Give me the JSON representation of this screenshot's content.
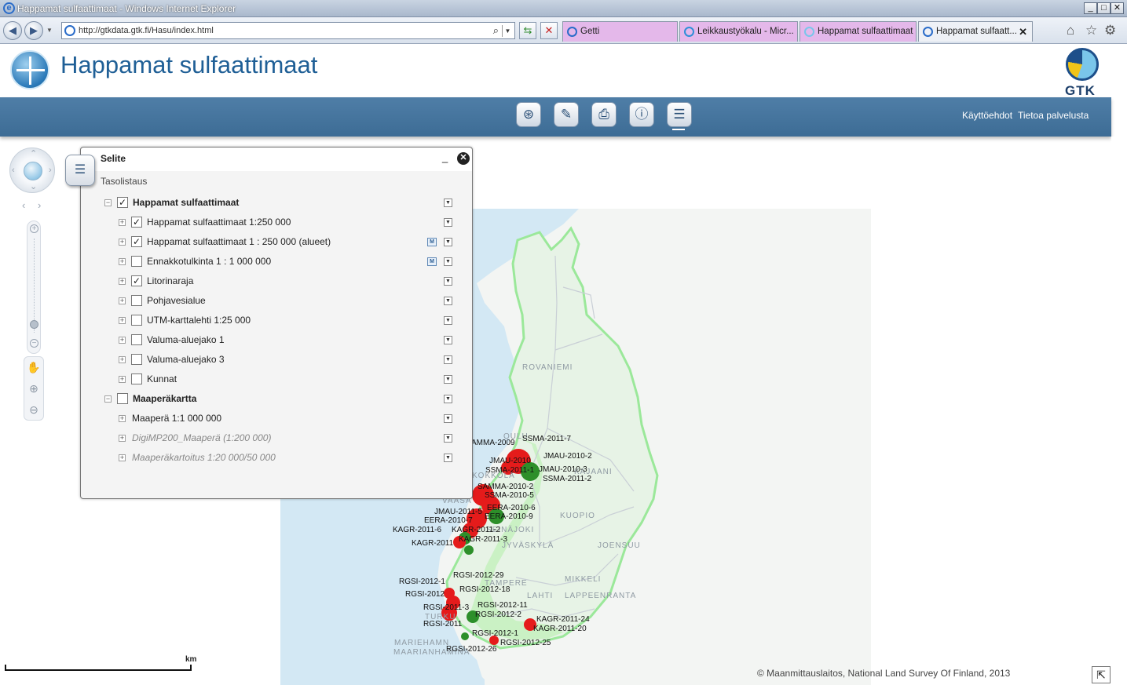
{
  "window": {
    "title": "Happamat sulfaattimaat - Windows Internet Explorer",
    "minimize": "_",
    "maximize": "□",
    "close": "✕"
  },
  "browser": {
    "url": "http://gtkdata.gtk.fi/Hasu/index.html",
    "tabs": [
      {
        "label": "Getti",
        "color": "#e4b8ea",
        "icon": "ie-icon"
      },
      {
        "label": "Leikkaustyökalu - Micr...",
        "color": "#e4b8ea",
        "icon": "windows-icon"
      },
      {
        "label": "Happamat sulfaattimaat",
        "color": "#e4b8ea",
        "icon": "gtk-icon"
      },
      {
        "label": "Happamat sulfaatt...",
        "color": "#eef1f6",
        "icon": "ie-icon",
        "close": "✕"
      }
    ],
    "icons": [
      "home-icon",
      "favorites-star-icon",
      "settings-gear-icon"
    ]
  },
  "app": {
    "title": "Happamat sulfaattimaat",
    "brand": "GTK",
    "links": [
      "Käyttöehdot",
      "Tietoa palvelusta"
    ],
    "tools": [
      "search-binoculars-icon",
      "draw-tool-icon",
      "print-icon",
      "info-icon",
      "legend-list-icon"
    ],
    "accent": "#4a79a2"
  },
  "legend": {
    "title": "Selite",
    "minimize": "_",
    "close": "✕",
    "subtitle": "Tasolistaus",
    "rows": [
      {
        "label": "Happamat sulfaattimaat",
        "level": 0,
        "checked": true,
        "bold": true,
        "toggle": "−",
        "grey": false,
        "meta": false
      },
      {
        "label": "Happamat sulfaattimaat 1:250 000",
        "level": 1,
        "checked": true,
        "bold": false,
        "toggle": "+",
        "grey": false,
        "meta": false
      },
      {
        "label": "Happamat sulfaattimaat 1 : 250 000 (alueet)",
        "level": 1,
        "checked": true,
        "bold": false,
        "toggle": "+",
        "grey": false,
        "meta": true
      },
      {
        "label": "Ennakkotulkinta 1 : 1 000 000",
        "level": 1,
        "checked": false,
        "bold": false,
        "toggle": "+",
        "grey": false,
        "meta": true
      },
      {
        "label": "Litorinaraja",
        "level": 1,
        "checked": true,
        "bold": false,
        "toggle": "+",
        "grey": false,
        "meta": false
      },
      {
        "label": "Pohjavesialue",
        "level": 1,
        "checked": false,
        "bold": false,
        "toggle": "+",
        "grey": false,
        "meta": false
      },
      {
        "label": "UTM-karttalehti 1:25 000",
        "level": 1,
        "checked": false,
        "bold": false,
        "toggle": "+",
        "grey": false,
        "meta": false
      },
      {
        "label": "Valuma-aluejako 1",
        "level": 1,
        "checked": false,
        "bold": false,
        "toggle": "+",
        "grey": false,
        "meta": false
      },
      {
        "label": "Valuma-aluejako 3",
        "level": 1,
        "checked": false,
        "bold": false,
        "toggle": "+",
        "grey": false,
        "meta": false
      },
      {
        "label": "Kunnat",
        "level": 1,
        "checked": false,
        "bold": false,
        "toggle": "+",
        "grey": false,
        "meta": false
      },
      {
        "label": "Maaperäkartta",
        "level": 0,
        "checked": false,
        "bold": true,
        "toggle": "−",
        "grey": false,
        "meta": false
      },
      {
        "label": "Maaperä 1:1 000 000",
        "level": 2,
        "checked": null,
        "bold": false,
        "toggle": "+",
        "grey": false,
        "meta": false
      },
      {
        "label": "DigiMP200_Maaperä (1:200 000)",
        "level": 2,
        "checked": null,
        "bold": false,
        "toggle": "+",
        "grey": true,
        "meta": false
      },
      {
        "label": "Maaperäkartoitus 1:20 000/50 000",
        "level": 2,
        "checked": null,
        "bold": false,
        "toggle": "+",
        "grey": true,
        "meta": false
      }
    ]
  },
  "map": {
    "scale_unit": "km",
    "credit": "© Maanmittauslaitos, National Land Survey Of Finland, 2013",
    "cities": [
      "ROVANIEMI",
      "OULU",
      "KOKKOLA",
      "VAASA",
      "KUOPIO",
      "JYVÄSKYLÄ",
      "JOENSUU",
      "SEINÄJOKI",
      "TAMPERE",
      "MIKKELI",
      "LAHTI",
      "LAPPEENRANTA",
      "TURKU",
      "MARIEHAMN",
      "MAARIANHAMINA",
      "KAJAANI"
    ],
    "sites": [
      "SSMA-2011-7",
      "AMMA-2009",
      "JMAU-2010-2",
      "JMAU-2010",
      "SSMA-2011-1",
      "JMAU-2010-3",
      "SSMA-2011-2",
      "SAMMA-2010-2",
      "SSMA-2010-5",
      "EERA-2010-6",
      "JMAU-2011-5",
      "EERA-2010-9",
      "EERA-2010-7",
      "KAGR-2011-6",
      "KAGR-2011-2",
      "KAGR-2011-3",
      "KAGR-2011",
      "RGSI-2012-29",
      "RGSI-2012-1",
      "RGSI-2012-18",
      "RGSI-2012",
      "RGSI-2012-11",
      "RGSI-2011-3",
      "RGSI-2012-2",
      "RGSI-2011",
      "KAGR-2011-24",
      "KAGR-2011-20",
      "RGSI-2012-1b",
      "RGSI-2012-26",
      "RGSI-2012-25"
    ],
    "colors": {
      "water": "#d3e8f4",
      "land": "#f4f6f4",
      "litorina": "#c6f1c0",
      "acid": "#e51b1b",
      "area": "#2d8f2a"
    }
  }
}
